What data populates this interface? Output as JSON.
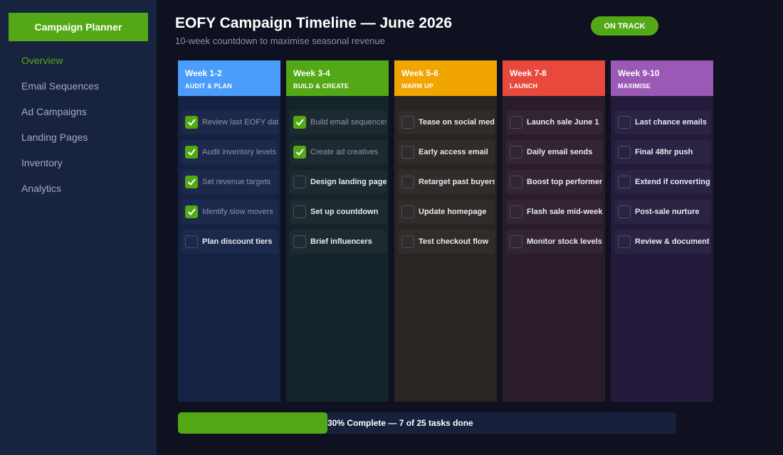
{
  "sidebar": {
    "brand": "Campaign Planner",
    "items": [
      {
        "label": "Overview",
        "active": true
      },
      {
        "label": "Email Sequences",
        "active": false
      },
      {
        "label": "Ad Campaigns",
        "active": false
      },
      {
        "label": "Landing Pages",
        "active": false
      },
      {
        "label": "Inventory",
        "active": false
      },
      {
        "label": "Analytics",
        "active": false
      }
    ]
  },
  "header": {
    "title": "EOFY Campaign Timeline — June 2026",
    "subtitle": "10-week countdown to maximise seasonal revenue",
    "status": "ON TRACK"
  },
  "columns": [
    {
      "title": "Week 1-2",
      "subtitle": "AUDIT & PLAN",
      "header_color": "#4a9dfb",
      "body_color": "#152244",
      "tasks": [
        {
          "label": "Review last EOFY data",
          "done": true
        },
        {
          "label": "Audit inventory levels",
          "done": true
        },
        {
          "label": "Set revenue targets",
          "done": true
        },
        {
          "label": "Identify slow movers",
          "done": true
        },
        {
          "label": "Plan discount tiers",
          "done": false
        }
      ]
    },
    {
      "title": "Week 3-4",
      "subtitle": "BUILD & CREATE",
      "header_color": "#52a915",
      "body_color": "#15242a",
      "tasks": [
        {
          "label": "Build email sequences",
          "done": true
        },
        {
          "label": "Create ad creatives",
          "done": true
        },
        {
          "label": "Design landing page",
          "done": false
        },
        {
          "label": "Set up countdown",
          "done": false
        },
        {
          "label": "Brief influencers",
          "done": false
        }
      ]
    },
    {
      "title": "Week 5-6",
      "subtitle": "WARM UP",
      "header_color": "#f0a500",
      "body_color": "#2a2422",
      "tasks": [
        {
          "label": "Tease on social media",
          "done": false
        },
        {
          "label": "Early access email",
          "done": false
        },
        {
          "label": "Retarget past buyers",
          "done": false
        },
        {
          "label": "Update homepage",
          "done": false
        },
        {
          "label": "Test checkout flow",
          "done": false
        }
      ]
    },
    {
      "title": "Week 7-8",
      "subtitle": "LAUNCH",
      "header_color": "#e8493c",
      "body_color": "#2b1c2a",
      "tasks": [
        {
          "label": "Launch sale June 1",
          "done": false
        },
        {
          "label": "Daily email sends",
          "done": false
        },
        {
          "label": "Boost top performers",
          "done": false
        },
        {
          "label": "Flash sale mid-week",
          "done": false
        },
        {
          "label": "Monitor stock levels",
          "done": false
        }
      ]
    },
    {
      "title": "Week 9-10",
      "subtitle": "MAXIMISE",
      "header_color": "#9b59b6",
      "body_color": "#241b3c",
      "tasks": [
        {
          "label": "Last chance emails",
          "done": false
        },
        {
          "label": "Final 48hr push",
          "done": false
        },
        {
          "label": "Extend if converting",
          "done": false
        },
        {
          "label": "Post-sale nurture",
          "done": false
        },
        {
          "label": "Review & document",
          "done": false
        }
      ]
    }
  ],
  "progress": {
    "fraction": 0.3,
    "label": "30% Complete — 7 of 25 tasks done"
  },
  "colors": {
    "accent": "#52a915",
    "background": "#0f1020",
    "sidebar": "#182340"
  },
  "icons": {
    "checkbox_checked": "checkmark-icon"
  }
}
